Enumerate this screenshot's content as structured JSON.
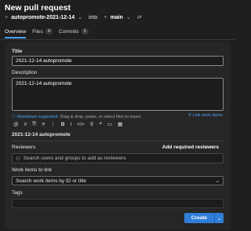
{
  "page": {
    "title": "New pull request"
  },
  "branches": {
    "source": "autopromote-2021-12-14",
    "into": "into",
    "target": "main"
  },
  "tabs": [
    {
      "label": "Overview",
      "count": null
    },
    {
      "label": "Files",
      "count": "4"
    },
    {
      "label": "Commits",
      "count": "1"
    }
  ],
  "form": {
    "title_label": "Title",
    "title_value": "2021-12-14 autopromote",
    "description_label": "Description",
    "description_value": "2021-12-14 autopromote",
    "markdown_link": "Markdown supported.",
    "markdown_hint": " Drag & drop, paste, or select files to insert.",
    "link_work_items": "Link work items.",
    "preview_text": "2021-12-14 autopromote",
    "reviewers_label": "Reviewers",
    "add_required_reviewers": "Add required reviewers",
    "reviewers_placeholder": "Search users and groups to add as reviewers",
    "work_items_label": "Work items to link",
    "work_items_placeholder": "Search work items by ID or title",
    "tags_label": "Tags",
    "create_label": "Create"
  },
  "toolbar_icons": [
    "mention-icon",
    "hash-icon",
    "list-icon",
    "bullets-icon",
    "numbered-list-icon",
    "bold-icon",
    "italic-icon",
    "code-icon",
    "link-icon",
    "quote-icon",
    "image-icon",
    "table-icon"
  ],
  "colors": {
    "accent": "#2f7ed8",
    "link": "#4aa3f5"
  }
}
